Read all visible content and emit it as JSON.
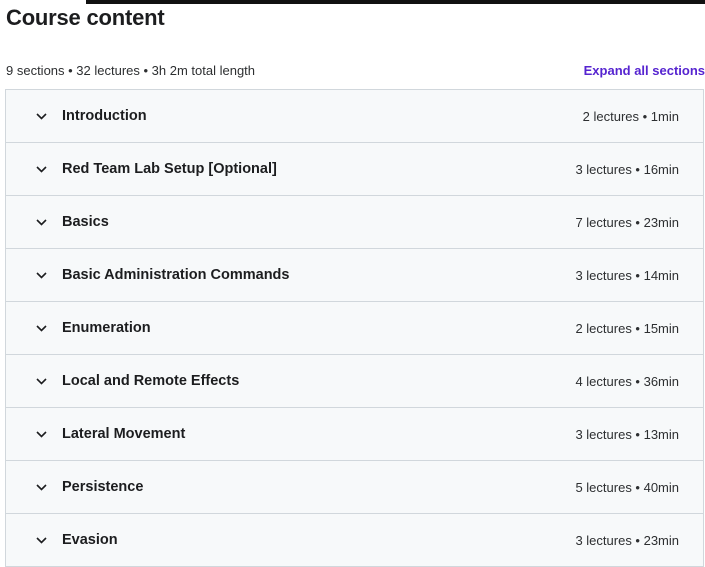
{
  "header": {
    "title": "Course content"
  },
  "summary": {
    "text": "9 sections • 32 lectures • 3h 2m total length",
    "expand_all_label": "Expand all sections"
  },
  "colors": {
    "accent": "#5624d0",
    "section_bg": "#f7f9fa",
    "border": "#d1d7dc"
  },
  "sections": [
    {
      "title": "Introduction",
      "meta": "2 lectures • 1min",
      "icon": "chevron-down-icon"
    },
    {
      "title": "Red Team Lab Setup [Optional]",
      "meta": "3 lectures • 16min",
      "icon": "chevron-down-icon"
    },
    {
      "title": "Basics",
      "meta": "7 lectures • 23min",
      "icon": "chevron-down-icon"
    },
    {
      "title": "Basic Administration Commands",
      "meta": "3 lectures • 14min",
      "icon": "chevron-down-icon"
    },
    {
      "title": "Enumeration",
      "meta": "2 lectures • 15min",
      "icon": "chevron-down-icon"
    },
    {
      "title": "Local and Remote Effects",
      "meta": "4 lectures • 36min",
      "icon": "chevron-down-icon"
    },
    {
      "title": "Lateral Movement",
      "meta": "3 lectures • 13min",
      "icon": "chevron-down-icon"
    },
    {
      "title": "Persistence",
      "meta": "5 lectures • 40min",
      "icon": "chevron-down-icon"
    },
    {
      "title": "Evasion",
      "meta": "3 lectures • 23min",
      "icon": "chevron-down-icon"
    }
  ]
}
